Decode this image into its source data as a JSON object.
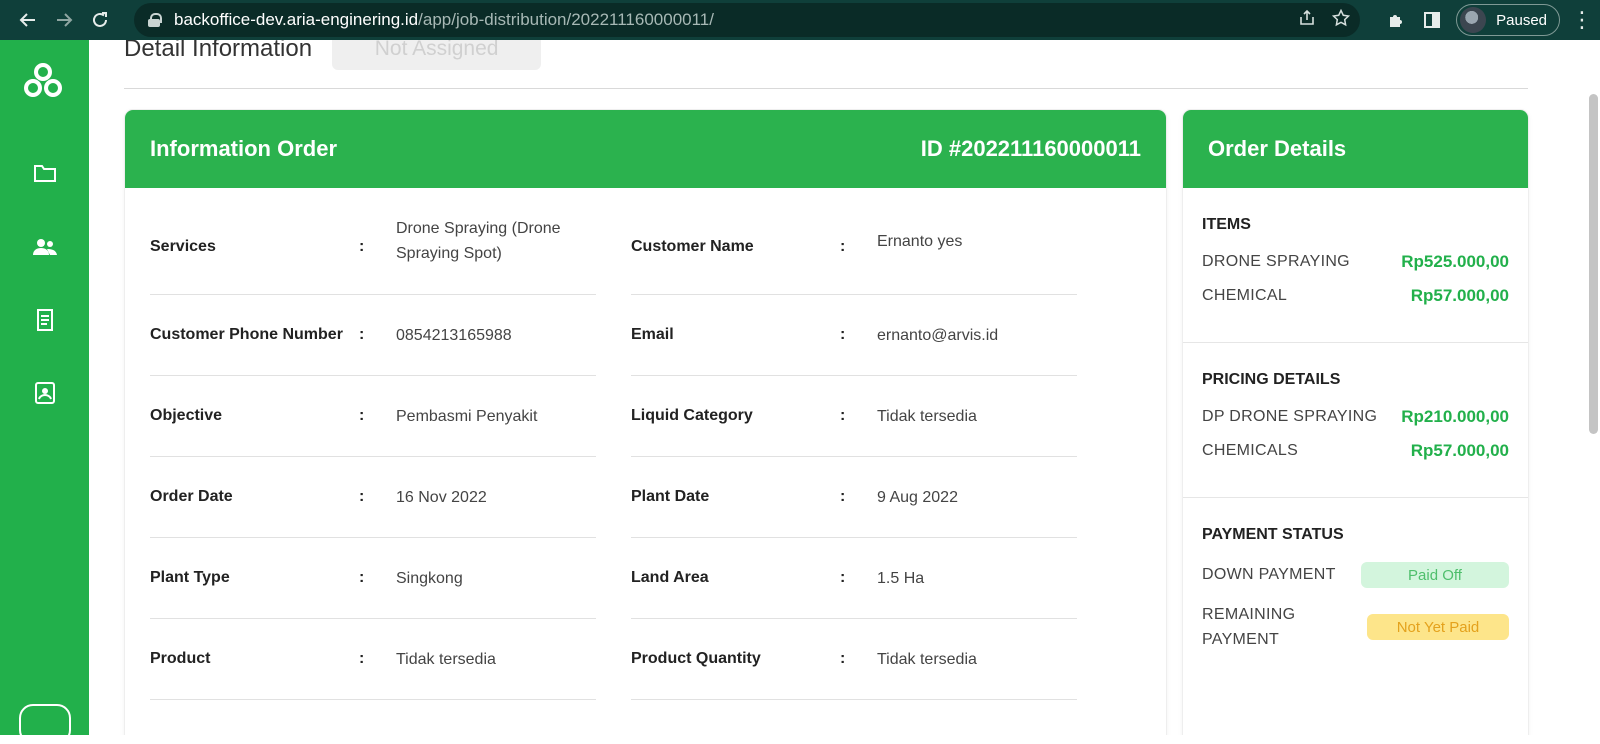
{
  "browser": {
    "url_host": "backoffice-dev.aria-enginering.id",
    "url_path": "/app/job-distribution/202211160000011/",
    "profile_label": "Paused"
  },
  "page": {
    "title": "Detail Information",
    "status": "Not Assigned"
  },
  "info_order": {
    "title": "Information Order",
    "id_label": "ID #202211160000011",
    "colon": ":",
    "fields": [
      {
        "label": "Services",
        "value": "Drone Spraying (Drone Spraying Spot)"
      },
      {
        "label": "Customer Name",
        "value": "Ernanto yes"
      },
      {
        "label": "Customer Phone Number",
        "value": "0854213165988"
      },
      {
        "label": "Email",
        "value": "ernanto@arvis.id"
      },
      {
        "label": "Objective",
        "value": "Pembasmi Penyakit"
      },
      {
        "label": "Liquid Category",
        "value": "Tidak tersedia"
      },
      {
        "label": "Order Date",
        "value": "16 Nov 2022"
      },
      {
        "label": "Plant Date",
        "value": "9 Aug 2022"
      },
      {
        "label": "Plant Type",
        "value": "Singkong"
      },
      {
        "label": "Land Area",
        "value": "1.5 Ha"
      },
      {
        "label": "Product",
        "value": "Tidak tersedia"
      },
      {
        "label": "Product Quantity",
        "value": "Tidak tersedia"
      }
    ]
  },
  "order_details": {
    "title": "Order Details",
    "items": {
      "title": "ITEMS",
      "lines": [
        {
          "name": "DRONE SPRAYING",
          "amount": "Rp525.000,00"
        },
        {
          "name": "CHEMICAL",
          "amount": "Rp57.000,00"
        }
      ]
    },
    "pricing": {
      "title": "PRICING DETAILS",
      "lines": [
        {
          "name": "DP DRONE SPRAYING",
          "amount": "Rp210.000,00"
        },
        {
          "name": "CHEMICALS",
          "amount": "Rp57.000,00"
        }
      ]
    },
    "payment": {
      "title": "PAYMENT STATUS",
      "down_payment_label": "DOWN PAYMENT",
      "down_payment_status": "Paid Off",
      "remaining_label": "REMAINING PAYMENT",
      "remaining_status": "Not Yet Paid"
    }
  },
  "colors": {
    "brand_green": "#22b04b",
    "header_green": "#2bb24e",
    "paid_bg": "#d3f5dd",
    "unpaid_bg": "#fde58a"
  },
  "icons": {
    "sidebar": [
      "app-logo-icon",
      "folder-icon",
      "users-icon",
      "document-icon",
      "contact-card-icon"
    ]
  }
}
